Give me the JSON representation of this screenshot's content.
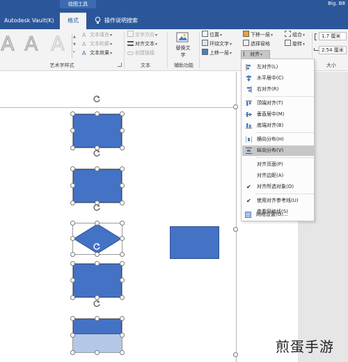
{
  "titlebar": {
    "context_group": "绘图工具",
    "account": "Big. B8",
    "tabs": [
      "Autodesk Vault(K)",
      "格式"
    ],
    "tell_me": "操作说明搜索"
  },
  "ribbon": {
    "wordart_letters": [
      "A",
      "A",
      "A"
    ],
    "text_fill": "文本填充",
    "text_outline": "文本轮廓",
    "text_effects": "文本效果",
    "text_direction": "文字方向",
    "align_text": "对齐文本",
    "create_link": "创建链接",
    "alt_text": "替换文字",
    "position": "位置",
    "wrap_text": "环绕文字",
    "bring_forward": "上移一层",
    "send_backward": "下移一层",
    "selection_pane": "选择窗格",
    "align": "对齐",
    "group": "组合",
    "rotate": "旋转",
    "height_value": "1.7 厘米",
    "width_value": "2.54 厘米",
    "group_labels": {
      "wordart": "艺术字样式",
      "text": "文本",
      "accessibility": "辅助功能",
      "size": "大小"
    }
  },
  "align_menu": {
    "items": [
      {
        "label": "左对齐(L)",
        "icon": "align-left-icon"
      },
      {
        "label": "水平居中(C)",
        "icon": "align-center-icon"
      },
      {
        "label": "右对齐(R)",
        "icon": "align-right-icon"
      },
      {
        "label": "顶端对齐(T)",
        "icon": "align-top-icon"
      },
      {
        "label": "垂直居中(M)",
        "icon": "align-middle-icon"
      },
      {
        "label": "底端对齐(B)",
        "icon": "align-bottom-icon"
      },
      {
        "label": "横向分布(H)",
        "icon": "distribute-horizontal-icon"
      },
      {
        "label": "纵向分布(V)",
        "icon": "distribute-vertical-icon"
      },
      {
        "label": "对齐页面(P)",
        "icon": ""
      },
      {
        "label": "对齐边距(A)",
        "icon": ""
      },
      {
        "label": "对齐所选对象(O)",
        "icon": "check-icon"
      },
      {
        "label": "使用对齐参考线(U)",
        "icon": "check-icon"
      },
      {
        "label": "查看网格线(S)",
        "icon": ""
      },
      {
        "label": "网格设置(G)...",
        "icon": "grid-settings-icon"
      }
    ],
    "highlighted_index": 7
  },
  "watermark": "煎蛋手游",
  "colors": {
    "title_bar": "#2b579a",
    "shape_fill": "#4472c4",
    "shape_faded": "#b4c7e7",
    "menu_hover": "#c7c7c7"
  }
}
